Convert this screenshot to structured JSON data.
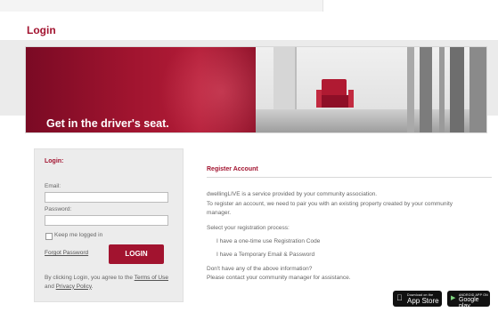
{
  "page": {
    "title": "Login"
  },
  "hero": {
    "tagline": "Get in the driver's seat."
  },
  "login": {
    "heading": "Login:",
    "email_label": "Email:",
    "email_value": "",
    "password_label": "Password:",
    "password_value": "",
    "keep_logged_in": "Keep me logged in",
    "forgot_password": "Forgot Password",
    "button": "LOGIN",
    "terms_prefix": "By clicking Login, you agree to the ",
    "terms_link": "Terms of Use",
    "terms_and": " and ",
    "privacy_link": "Privacy Policy",
    "terms_suffix": "."
  },
  "register": {
    "title": "Register Account",
    "intro_1": "dwellingLIVE is a service provided by your community association.",
    "intro_2": "To register an account, we need to pair you with an existing property created by your community",
    "intro_3": "manager.",
    "select_process": "Select your registration process:",
    "option_1": "I have a one-time use Registration Code",
    "option_2": "I have a Temporary Email & Password",
    "no_info_1": "Don't have any of the above information?",
    "no_info_2": "Please contact your community manager for assistance."
  },
  "apps": {
    "app_store_small": "Download on the",
    "app_store_big": "App Store",
    "google_small": "ANDROID APP ON",
    "google_big": "Google play"
  },
  "colors": {
    "brand": "#a2132f",
    "box_bg": "#ececec"
  },
  "icons": {
    "apple": "apple-icon",
    "play": "play-icon"
  }
}
